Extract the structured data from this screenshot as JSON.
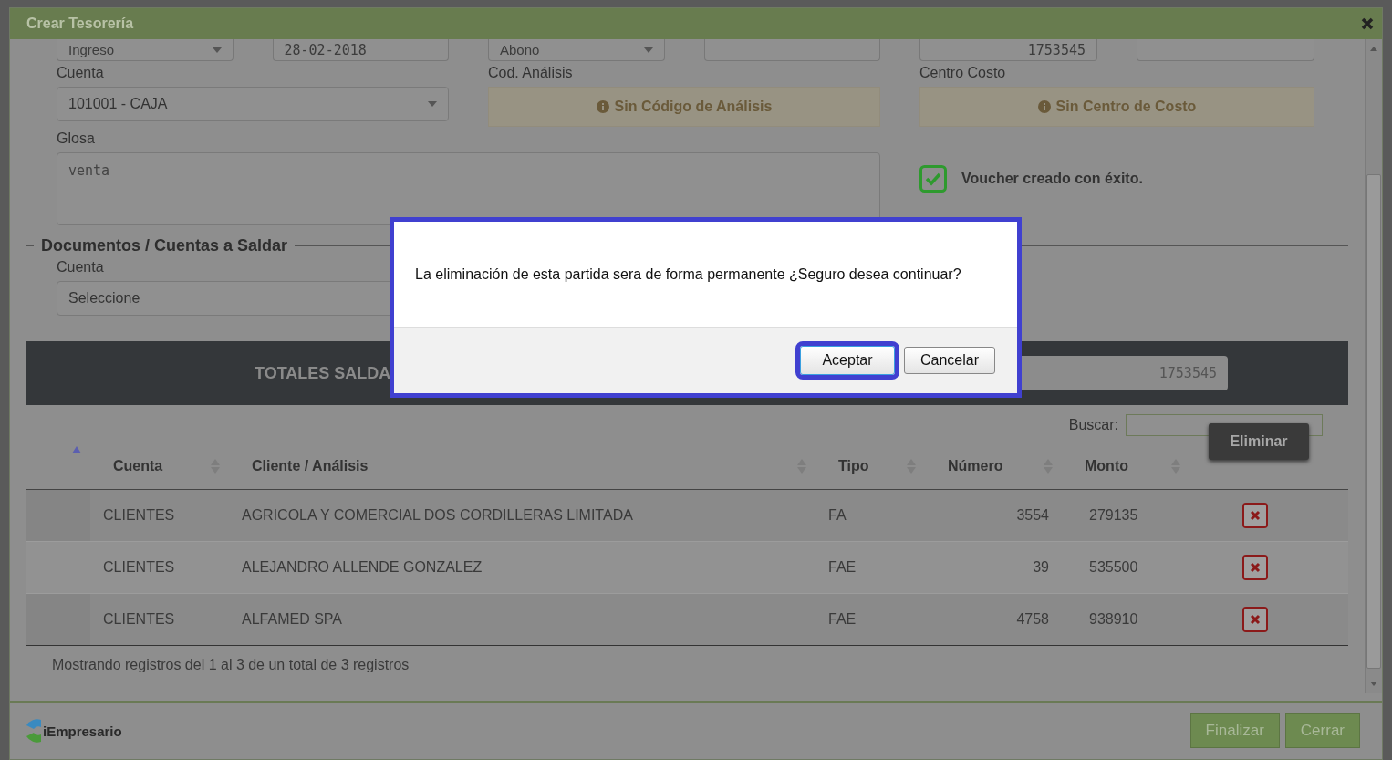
{
  "window": {
    "title": "Crear Tesorería"
  },
  "top_fields": [
    {
      "kind": "select",
      "value": "Ingreso"
    },
    {
      "kind": "text",
      "value": "28-02-2018"
    },
    {
      "kind": "select",
      "value": "Abono"
    },
    {
      "kind": "text"
    },
    {
      "kind": "number",
      "value": "1753545"
    },
    {
      "kind": "text"
    }
  ],
  "cuenta": {
    "label": "Cuenta",
    "value": "101001 - CAJA"
  },
  "analysis": {
    "label": "Cod. Análisis",
    "notice": "Sin Código de Análisis"
  },
  "cost_center": {
    "label": "Centro Costo",
    "notice": "Sin Centro de Costo"
  },
  "glosa": {
    "label": "Glosa",
    "value": "venta"
  },
  "success": {
    "message": "Voucher creado con éxito.",
    "checked": true
  },
  "documents": {
    "legend": "Documentos / Cuentas a Saldar",
    "cuenta_label": "Cuenta",
    "cuenta_value": "Seleccione"
  },
  "totals": {
    "label": "TOTALES SALDA",
    "value": "1753545"
  },
  "search": {
    "label": "Buscar:"
  },
  "table": {
    "columns": [
      {
        "sorted": true
      },
      {
        "label": "Cuenta",
        "sorted": false
      },
      {
        "label": "Cliente / Análisis",
        "sorted": false
      },
      {
        "label": "Tipo",
        "sorted": false
      },
      {
        "label": "Número",
        "sorted": false
      },
      {
        "label": "Monto",
        "sorted": false
      }
    ],
    "rows": [
      {
        "cuenta": "CLIENTES",
        "cliente": "AGRICOLA Y COMERCIAL DOS CORDILLERAS LIMITADA",
        "tipo": "FA",
        "numero": "3554",
        "monto": "279135"
      },
      {
        "cuenta": "CLIENTES",
        "cliente": "ALEJANDRO ALLENDE GONZALEZ",
        "tipo": "FAE",
        "numero": "39",
        "monto": "535500"
      },
      {
        "cuenta": "CLIENTES",
        "cliente": "ALFAMED SPA",
        "tipo": "FAE",
        "numero": "4758",
        "monto": "938910"
      }
    ],
    "tooltip": "Eliminar",
    "info": "Mostrando registros del 1 al 3 de un total de 3 registros"
  },
  "footer": {
    "logo": "iEmpresario",
    "buttons": [
      "Finalizar",
      "Cerrar"
    ]
  },
  "dialog": {
    "message": "La eliminación de esta partida sera de forma permanente ¿Seguro desea continuar?",
    "buttons": [
      {
        "label": "Aceptar",
        "selected": true
      },
      {
        "label": "Cancelar",
        "selected": false
      }
    ]
  }
}
